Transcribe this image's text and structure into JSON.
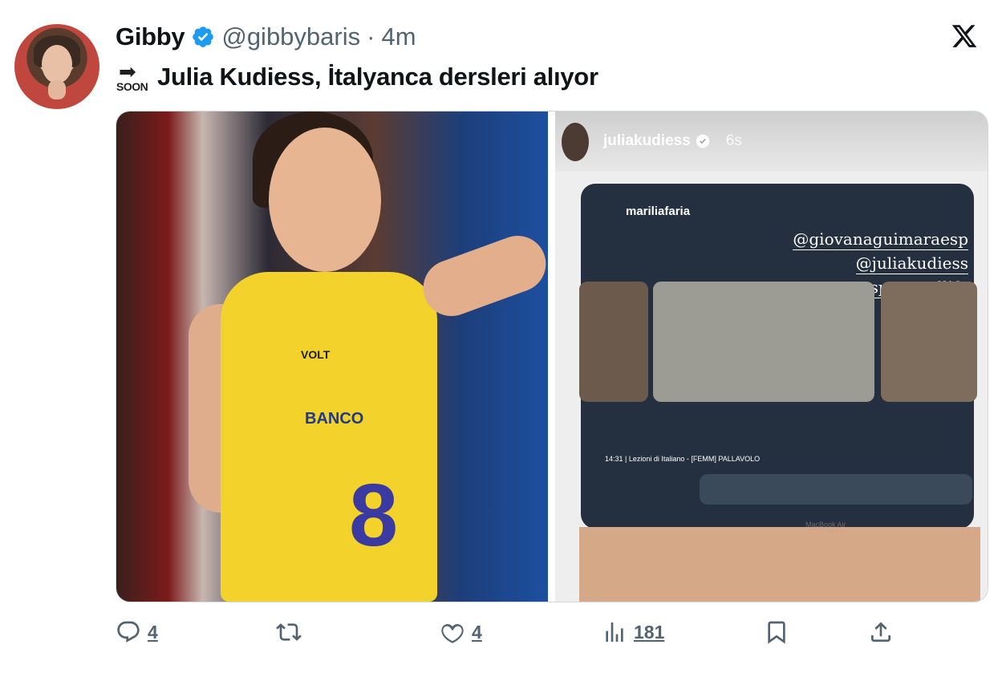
{
  "tweet": {
    "author_name": "Gibby",
    "handle": "@gibbybaris",
    "separator": "·",
    "time": "4m",
    "emoji_label": "SOON",
    "text": "Julia Kudiess, İtalyanca dersleri alıyor"
  },
  "story": {
    "username": "juliakudiess",
    "time": "6s",
    "call_user": "mariliafaria",
    "mentions": [
      "@giovanaguimaraesp",
      "@juliakudiess",
      "@sportandlife"
    ],
    "caption": "14:31 | Lezioni di Italiano - [FEMM] PALLAVOLO",
    "device_label": "MacBook Air"
  },
  "actions": {
    "replies": "4",
    "likes": "4",
    "views": "181"
  },
  "colors": {
    "verified": "#1d9bf0",
    "secondary_text": "#536471",
    "text": "#0f1419"
  }
}
